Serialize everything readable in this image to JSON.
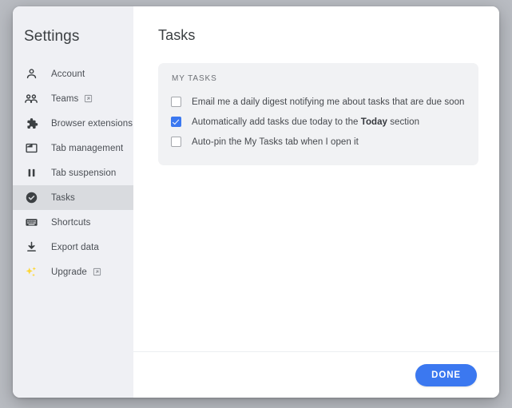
{
  "sidebar": {
    "title": "Settings",
    "items": [
      {
        "label": "Account",
        "icon": "person-icon",
        "external": false,
        "active": false
      },
      {
        "label": "Teams",
        "icon": "people-icon",
        "external": true,
        "active": false
      },
      {
        "label": "Browser extensions",
        "icon": "puzzle-piece-icon",
        "external": false,
        "active": false
      },
      {
        "label": "Tab management",
        "icon": "window-icon",
        "external": false,
        "active": false
      },
      {
        "label": "Tab suspension",
        "icon": "pause-icon",
        "external": false,
        "active": false
      },
      {
        "label": "Tasks",
        "icon": "check-circle-icon",
        "external": false,
        "active": true
      },
      {
        "label": "Shortcuts",
        "icon": "keyboard-icon",
        "external": false,
        "active": false
      },
      {
        "label": "Export data",
        "icon": "download-icon",
        "external": false,
        "active": false
      },
      {
        "label": "Upgrade",
        "icon": "sparkles-icon",
        "external": true,
        "active": false
      }
    ]
  },
  "main": {
    "page_title": "Tasks",
    "card": {
      "heading": "MY TASKS",
      "options": [
        {
          "label": "Email me a daily digest notifying me about tasks that are due soon",
          "checked": false
        },
        {
          "label_before": "Automatically add tasks due today to the ",
          "label_bold": "Today",
          "label_after": " section",
          "checked": true
        },
        {
          "label": "Auto-pin the My Tasks tab when I open it",
          "checked": false
        }
      ]
    }
  },
  "footer": {
    "done_label": "DONE"
  },
  "colors": {
    "accent_blue": "#3b78f0",
    "sidebar_bg": "#eff0f4",
    "sidebar_active_bg": "#d9dbdf",
    "card_bg": "#f1f2f4",
    "text_primary": "#3c4043",
    "text_secondary": "#6d7075",
    "page_backdrop": "#b9bcc2",
    "sparkle_yellow": "#fdd633"
  }
}
